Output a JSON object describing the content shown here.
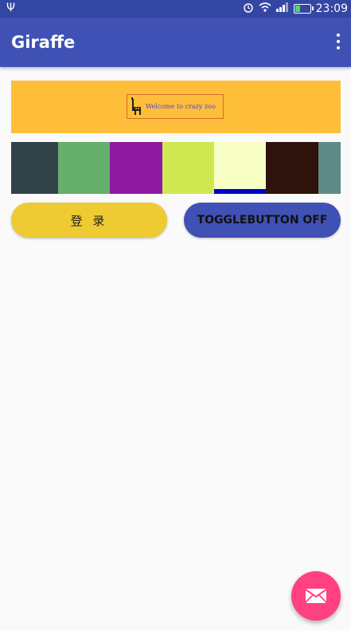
{
  "status_bar": {
    "usb_icon": "usb-icon",
    "alarm_icon": "alarm-icon",
    "wifi_icon": "wifi-icon",
    "signal_icon": "signal-icon",
    "battery_icon": "battery-icon",
    "time": "23:09"
  },
  "app_bar": {
    "title": "Giraffe",
    "overflow_icon": "more-vert-icon"
  },
  "banner": {
    "background": "#ffbe39",
    "text": "Welcome to crazy zoo",
    "logo_icon": "giraffe-icon"
  },
  "swatches": [
    {
      "color": "#32434a",
      "selected": false
    },
    {
      "color": "#66ae6b",
      "selected": false
    },
    {
      "color": "#8e1aa1",
      "selected": false
    },
    {
      "color": "#cfe851",
      "selected": false
    },
    {
      "color": "#f7ffc4",
      "selected": true,
      "indicator": "#0000cc"
    },
    {
      "color": "#2e130c",
      "selected": false
    },
    {
      "color": "#5e8b86",
      "selected": false
    }
  ],
  "buttons": {
    "login_label": "登 录",
    "toggle_label": "TOGGLEBUTTON OFF"
  },
  "fab": {
    "icon": "email-icon",
    "color": "#ff4081"
  }
}
